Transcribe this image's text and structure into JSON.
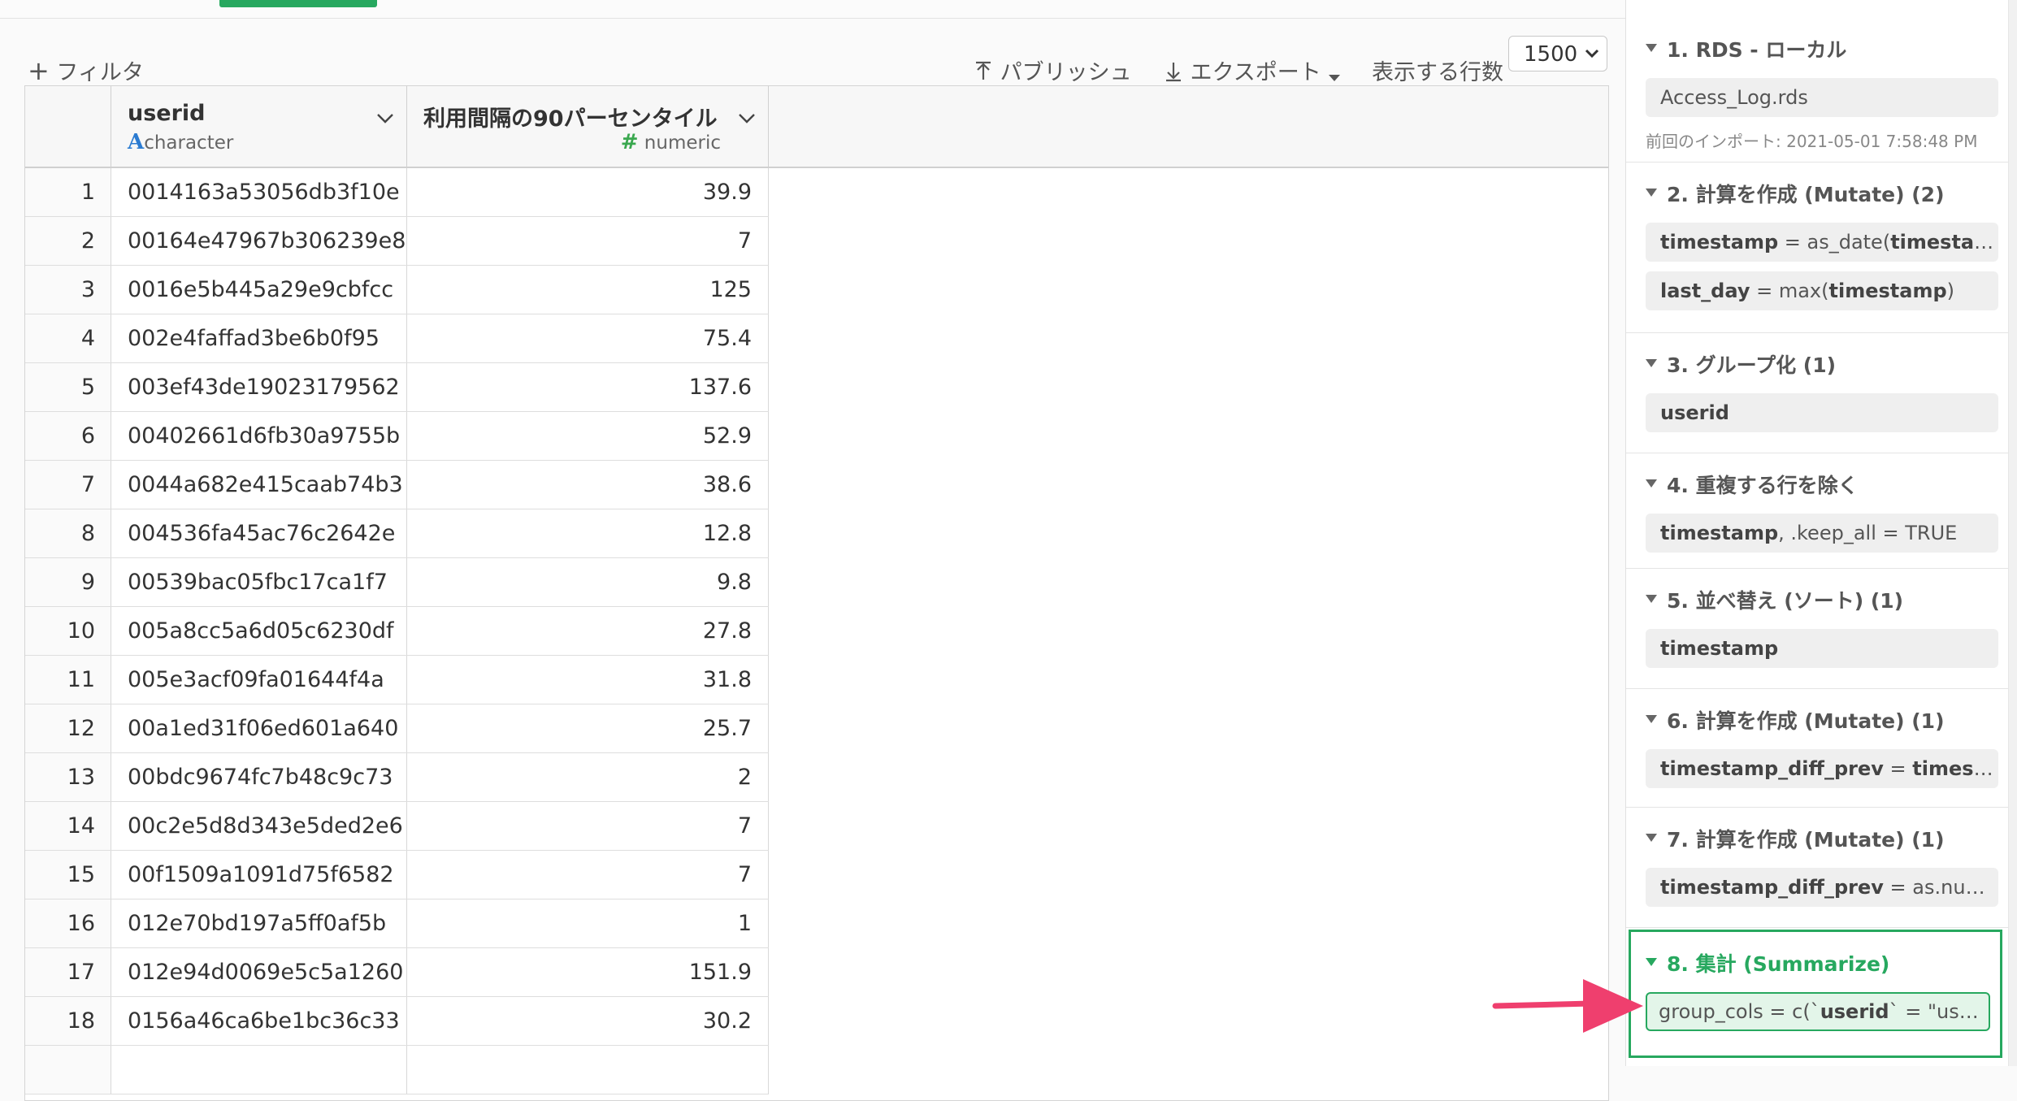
{
  "toolbar": {
    "filter_label": "フィルタ",
    "publish_label": "パブリッシュ",
    "export_label": "エクスポート",
    "rows_label": "表示する行数",
    "rows_value": "1500"
  },
  "table": {
    "columns": [
      {
        "name": "userid",
        "type": "character"
      },
      {
        "name": "利用間隔の90パーセンタイル",
        "type": "numeric"
      }
    ],
    "rows": [
      {
        "n": "1",
        "userid": "0014163a53056db3f10e",
        "value": "39.9"
      },
      {
        "n": "2",
        "userid": "00164e47967b306239e8",
        "value": "7"
      },
      {
        "n": "3",
        "userid": "0016e5b445a29e9cbfcc",
        "value": "125"
      },
      {
        "n": "4",
        "userid": "002e4faffad3be6b0f95",
        "value": "75.4"
      },
      {
        "n": "5",
        "userid": "003ef43de19023179562",
        "value": "137.6"
      },
      {
        "n": "6",
        "userid": "00402661d6fb30a9755b",
        "value": "52.9"
      },
      {
        "n": "7",
        "userid": "0044a682e415caab74b3",
        "value": "38.6"
      },
      {
        "n": "8",
        "userid": "004536fa45ac76c2642e",
        "value": "12.8"
      },
      {
        "n": "9",
        "userid": "00539bac05fbc17ca1f7",
        "value": "9.8"
      },
      {
        "n": "10",
        "userid": "005a8cc5a6d05c6230df",
        "value": "27.8"
      },
      {
        "n": "11",
        "userid": "005e3acf09fa01644f4a",
        "value": "31.8"
      },
      {
        "n": "12",
        "userid": "00a1ed31f06ed601a640",
        "value": "25.7"
      },
      {
        "n": "13",
        "userid": "00bdc9674fc7b48c9c73",
        "value": "2"
      },
      {
        "n": "14",
        "userid": "00c2e5d8d343e5ded2e6",
        "value": "7"
      },
      {
        "n": "15",
        "userid": "00f1509a1091d75f6582",
        "value": "7"
      },
      {
        "n": "16",
        "userid": "012e70bd197a5ff0af5b",
        "value": "1"
      },
      {
        "n": "17",
        "userid": "012e94d0069e5c5a1260",
        "value": "151.9"
      },
      {
        "n": "18",
        "userid": "0156a46ca6be1bc36c33",
        "value": "30.2"
      }
    ]
  },
  "steps": [
    {
      "title": "1. RDS - ローカル",
      "items": [
        "Access_Log.rds"
      ],
      "meta": "前回のインポート: 2021-05-01 7:58:48 PM"
    },
    {
      "title": "2. 計算を作成 (Mutate) (2)",
      "items": [
        {
          "b": "timestamp",
          "rest": " = as_date(",
          "b2": "timestamp",
          "tail": ")"
        },
        {
          "b": "last_day",
          "rest": " = max(",
          "b2": "timestamp",
          "tail": ")"
        }
      ]
    },
    {
      "title": "3. グループ化 (1)",
      "items": [
        {
          "b": "userid"
        }
      ]
    },
    {
      "title": "4. 重複する行を除く",
      "items": [
        {
          "b": "timestamp",
          "rest": ", .keep_all = TRUE"
        }
      ]
    },
    {
      "title": "5. 並べ替え (ソート) (1)",
      "items": [
        {
          "b": "timestamp"
        }
      ]
    },
    {
      "title": "6. 計算を作成 (Mutate) (1)",
      "items": [
        {
          "b": "timestamp_diff_prev",
          "rest": " = ",
          "b2": "timestamp",
          "tail": " …"
        }
      ]
    },
    {
      "title": "7. 計算を作成 (Mutate) (1)",
      "items": [
        {
          "b": "timestamp_diff_prev",
          "rest": " = as.numeric(…"
        }
      ]
    },
    {
      "title": "8. 集計 (Summarize)",
      "items": [
        {
          "pre": "group_cols = c(`",
          "b": "userid",
          "rest": "` = \"userid\"),…"
        }
      ]
    }
  ],
  "colors": {
    "accent": "#27a85f",
    "arrow": "#ef3f6e"
  }
}
